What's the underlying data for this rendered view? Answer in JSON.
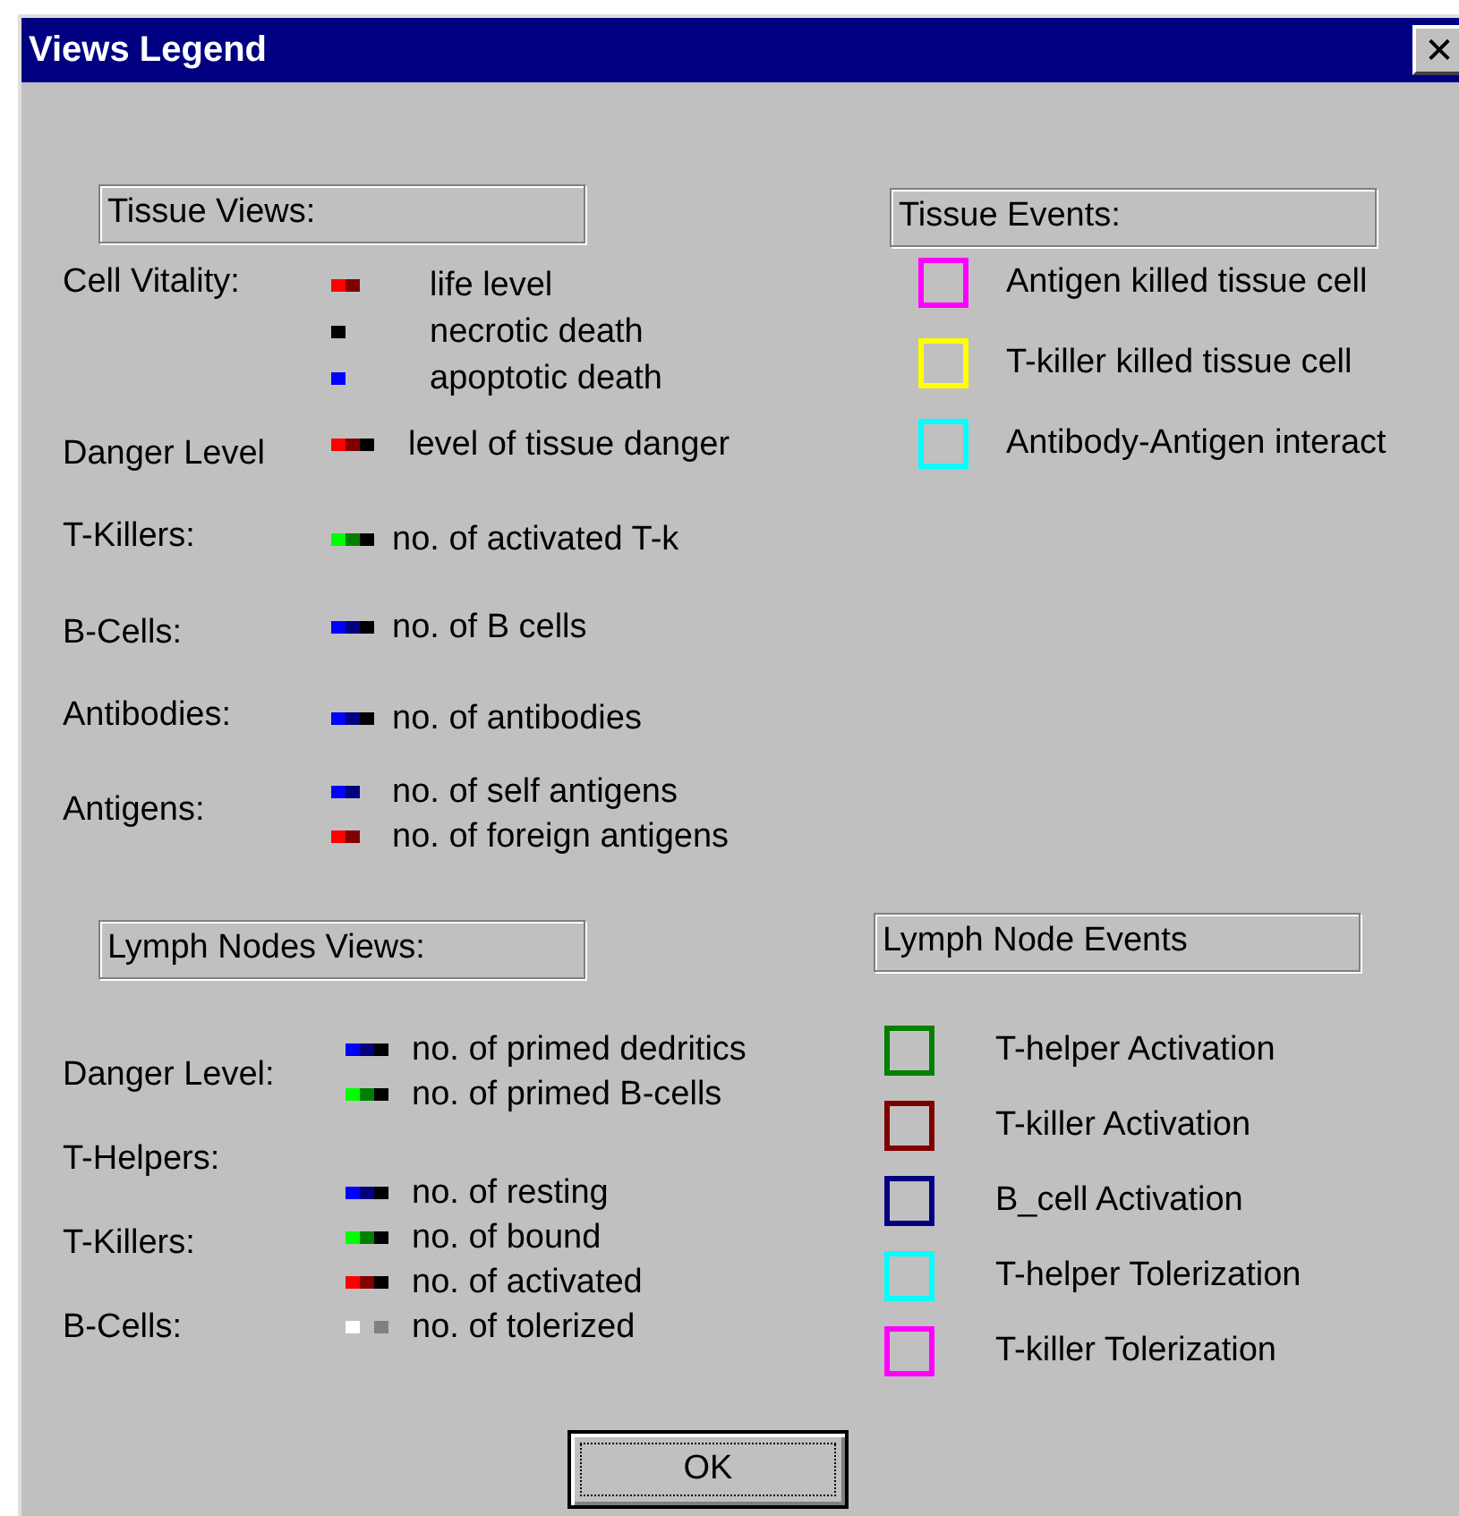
{
  "window": {
    "title": "Views Legend",
    "close": "✕"
  },
  "tissue_views": {
    "title": "Tissue Views:",
    "rows": [
      {
        "label": "Cell Vitality:",
        "entries": [
          {
            "segments": [
              {
                "color": "#ff0000"
              },
              {
                "color": "#800000"
              }
            ],
            "text": "life level"
          },
          {
            "segments": [
              {
                "color": "#000000"
              }
            ],
            "text": "necrotic death"
          },
          {
            "segments": [
              {
                "color": "#0000ff"
              }
            ],
            "text": "apoptotic death"
          }
        ]
      },
      {
        "label": "Danger Level",
        "entries": [
          {
            "segments": [
              {
                "color": "#ff0000"
              },
              {
                "color": "#800000"
              },
              {
                "color": "#000000"
              }
            ],
            "text": "level of tissue danger"
          }
        ]
      },
      {
        "label": "T-Killers:",
        "entries": [
          {
            "segments": [
              {
                "color": "#00ff00"
              },
              {
                "color": "#008000"
              },
              {
                "color": "#000000"
              }
            ],
            "text": "no. of activated T-k"
          }
        ]
      },
      {
        "label": "B-Cells:",
        "entries": [
          {
            "segments": [
              {
                "color": "#0000ff"
              },
              {
                "color": "#000080"
              },
              {
                "color": "#000000"
              }
            ],
            "text": "no. of B cells"
          }
        ]
      },
      {
        "label": "Antibodies:",
        "entries": [
          {
            "segments": [
              {
                "color": "#0000ff"
              },
              {
                "color": "#000080"
              },
              {
                "color": "#000000"
              }
            ],
            "text": "no. of antibodies"
          }
        ]
      },
      {
        "label": "Antigens:",
        "entries": [
          {
            "segments": [
              {
                "color": "#0000ff"
              },
              {
                "color": "#000080"
              }
            ],
            "text": "no. of self antigens"
          },
          {
            "segments": [
              {
                "color": "#ff0000"
              },
              {
                "color": "#800000"
              }
            ],
            "text": "no. of foreign antigens"
          }
        ]
      }
    ]
  },
  "tissue_events": {
    "title": "Tissue Events:",
    "items": [
      {
        "color": "#ff00ff",
        "text": "Antigen killed tissue cell"
      },
      {
        "color": "#ffff00",
        "text": "T-killer killed tissue cell"
      },
      {
        "color": "#00ffff",
        "text": "Antibody-Antigen interact"
      }
    ]
  },
  "lymph_views": {
    "title": "Lymph Nodes Views:",
    "labels": [
      "Danger Level:",
      "T-Helpers:",
      "T-Killers:",
      "B-Cells:"
    ],
    "groups": [
      [
        {
          "segments": [
            {
              "color": "#0000ff"
            },
            {
              "color": "#000080"
            },
            {
              "color": "#000000"
            }
          ],
          "text": "no. of primed dedritics"
        },
        {
          "segments": [
            {
              "color": "#00ff00"
            },
            {
              "color": "#008000"
            },
            {
              "color": "#000000"
            }
          ],
          "text": "no. of  primed B-cells"
        }
      ],
      [
        {
          "segments": [
            {
              "color": "#0000ff"
            },
            {
              "color": "#000080"
            },
            {
              "color": "#000000"
            }
          ],
          "text": "no. of resting"
        },
        {
          "segments": [
            {
              "color": "#00ff00"
            },
            {
              "color": "#008000"
            },
            {
              "color": "#000000"
            }
          ],
          "text": "no. of  bound"
        },
        {
          "segments": [
            {
              "color": "#ff0000"
            },
            {
              "color": "#800000"
            },
            {
              "color": "#000000"
            }
          ],
          "text": "no. of activated"
        },
        {
          "spaced": true,
          "segments": [
            {
              "color": "#ffffff"
            },
            {
              "color": "#808080"
            }
          ],
          "text": "no. of tolerized"
        }
      ]
    ]
  },
  "lymph_events": {
    "title": "Lymph Node Events",
    "items": [
      {
        "color": "#008000",
        "text": "T-helper Activation"
      },
      {
        "color": "#800000",
        "text": "T-killer Activation"
      },
      {
        "color": "#000080",
        "text": "B_cell Activation"
      },
      {
        "color": "#00ffff",
        "text": "T-helper Tolerization"
      },
      {
        "color": "#ff00ff",
        "text": "T-killer Tolerization"
      }
    ]
  },
  "ok_button": "OK"
}
